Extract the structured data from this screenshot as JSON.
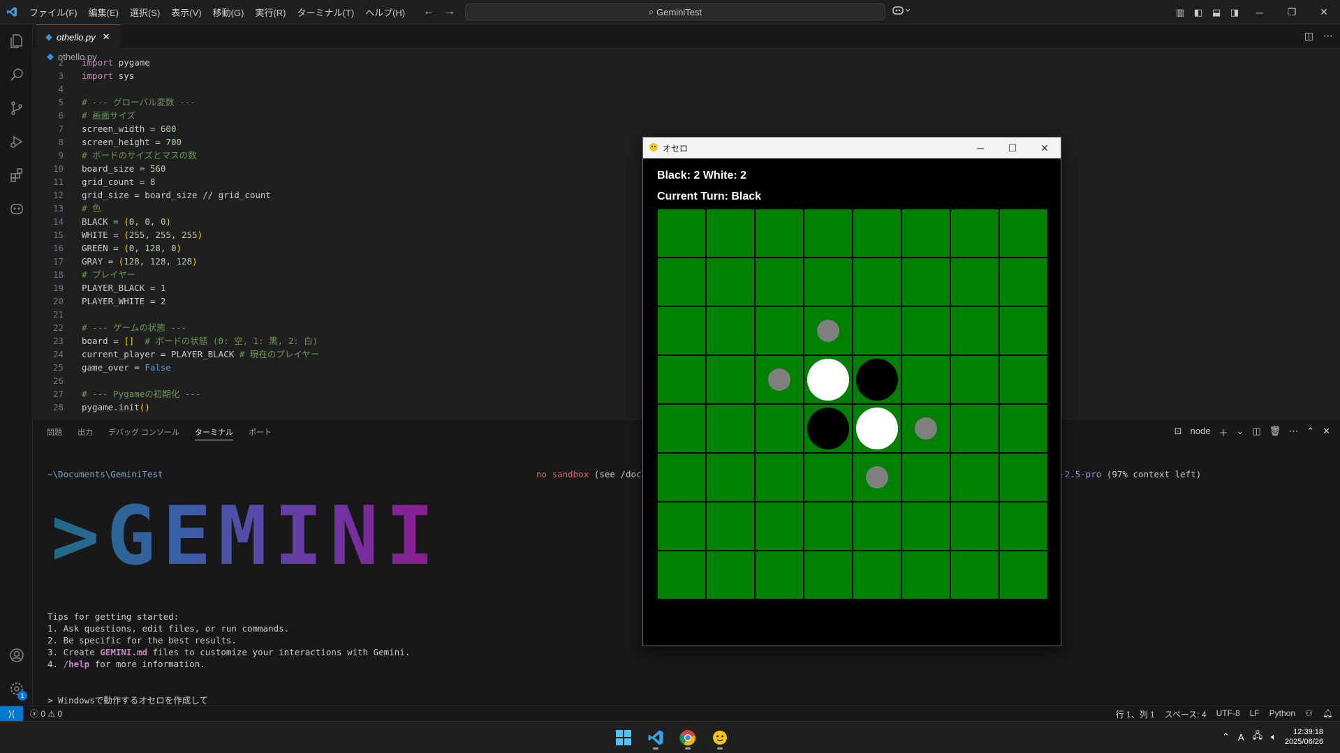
{
  "titlebar": {
    "menu": [
      "ファイル(F)",
      "編集(E)",
      "選択(S)",
      "表示(V)",
      "移動(G)",
      "実行(R)",
      "ターミナル(T)",
      "ヘルプ(H)"
    ],
    "search": "GeminiTest"
  },
  "editor": {
    "tab_label": "othello.py",
    "breadcrumb": "othello.py",
    "lines": [
      {
        "n": "2",
        "html": "<span class=\"kw\">import</span> pygame"
      },
      {
        "n": "3",
        "html": "<span class=\"kw\">import</span> sys"
      },
      {
        "n": "4",
        "html": ""
      },
      {
        "n": "5",
        "html": "<span class=\"cm\"># --- グローバル変数 ---</span>"
      },
      {
        "n": "6",
        "html": "<span class=\"cm\"># 画面サイズ</span>"
      },
      {
        "n": "7",
        "html": "screen_width = <span class=\"num\">600</span>"
      },
      {
        "n": "8",
        "html": "screen_height = <span class=\"num\">700</span>"
      },
      {
        "n": "9",
        "html": "<span class=\"cm\"># ボードのサイズとマスの数</span>"
      },
      {
        "n": "10",
        "html": "board_size = <span class=\"num\">560</span>"
      },
      {
        "n": "11",
        "html": "grid_count = <span class=\"num\">8</span>"
      },
      {
        "n": "12",
        "html": "grid_size = board_size // grid_count"
      },
      {
        "n": "13",
        "html": "<span class=\"cm\"># 色</span>"
      },
      {
        "n": "14",
        "html": "BLACK = <span class=\"br\">(</span><span class=\"num\">0</span>, <span class=\"num\">0</span>, <span class=\"num\">0</span><span class=\"br\">)</span>"
      },
      {
        "n": "15",
        "html": "WHITE = <span class=\"br\">(</span><span class=\"num\">255</span>, <span class=\"num\">255</span>, <span class=\"num\">255</span><span class=\"br\">)</span>"
      },
      {
        "n": "16",
        "html": "GREEN = <span class=\"br\">(</span><span class=\"num\">0</span>, <span class=\"num\">128</span>, <span class=\"num\">0</span><span class=\"br\">)</span>"
      },
      {
        "n": "17",
        "html": "GRAY = <span class=\"br\">(</span><span class=\"num\">128</span>, <span class=\"num\">128</span>, <span class=\"num\">128</span><span class=\"br\">)</span>"
      },
      {
        "n": "18",
        "html": "<span class=\"cm\"># プレイヤー</span>"
      },
      {
        "n": "19",
        "html": "PLAYER_BLACK = <span class=\"num\">1</span>"
      },
      {
        "n": "20",
        "html": "PLAYER_WHITE = <span class=\"num\">2</span>"
      },
      {
        "n": "21",
        "html": ""
      },
      {
        "n": "22",
        "html": "<span class=\"cm\"># --- ゲームの状態 ---</span>"
      },
      {
        "n": "23",
        "html": "board = <span class=\"br\">[]</span>  <span class=\"cm\"># ボードの状態 (0: 空, 1: 黒, 2: 白)</span>"
      },
      {
        "n": "24",
        "html": "current_player = PLAYER_BLACK <span class=\"cm\"># 現在のプレイヤー</span>"
      },
      {
        "n": "25",
        "html": "game_over = <span class=\"const\">False</span>"
      },
      {
        "n": "26",
        "html": ""
      },
      {
        "n": "27",
        "html": "<span class=\"cm\"># --- Pygameの初期化 ---</span>"
      },
      {
        "n": "28",
        "html": "pygame.init<span class=\"br\">()</span>"
      }
    ]
  },
  "panel": {
    "tabs": [
      "問題",
      "出力",
      "デバッグ コンソール",
      "ターミナル",
      "ポート"
    ],
    "active_tab": "ターミナル",
    "terminal_label": "node"
  },
  "terminal": {
    "path": "~\\Documents\\GeminiTest",
    "sandbox_red": "no sandbox",
    "sandbox_rest": " (see /docs)",
    "model": "ni-2.5-pro",
    "context": " (97% context left)",
    "banner": ">GEMINI",
    "tips_header": "Tips for getting started:",
    "tip1": "1. Ask questions, edit files, or run commands.",
    "tip2": "2. Be specific for the best results.",
    "tip3_a": "3. Create ",
    "tip3_b": "GEMINI.md",
    "tip3_c": " files to customize your interactions with Gemini.",
    "tip4_a": "4. ",
    "tip4_b": "/help",
    "tip4_c": " for more information.",
    "prompt": "> Windowsで動作するオセロを作成して"
  },
  "statusbar": {
    "errors": "0",
    "warnings": "0",
    "position": "行 1、列 1",
    "spaces": "スペース: 4",
    "encoding": "UTF-8",
    "eol": "LF",
    "language": "Python"
  },
  "taskbar": {
    "time": "12:39:18",
    "date": "2025/06/26",
    "ime": "A"
  },
  "game": {
    "window_title": "オセロ",
    "score": "Black: 2  White: 2",
    "turn": "Current Turn: Black",
    "grid_count": 8,
    "colors": {
      "board": "#008000",
      "line": "#000000",
      "black": "#000000",
      "white": "#ffffff",
      "hint": "#808080"
    },
    "discs": [
      {
        "row": 3,
        "col": 3,
        "color": "white"
      },
      {
        "row": 3,
        "col": 4,
        "color": "black"
      },
      {
        "row": 4,
        "col": 3,
        "color": "black"
      },
      {
        "row": 4,
        "col": 4,
        "color": "white"
      }
    ],
    "hints": [
      {
        "row": 2,
        "col": 3
      },
      {
        "row": 3,
        "col": 2
      },
      {
        "row": 4,
        "col": 5
      },
      {
        "row": 5,
        "col": 4
      }
    ]
  }
}
